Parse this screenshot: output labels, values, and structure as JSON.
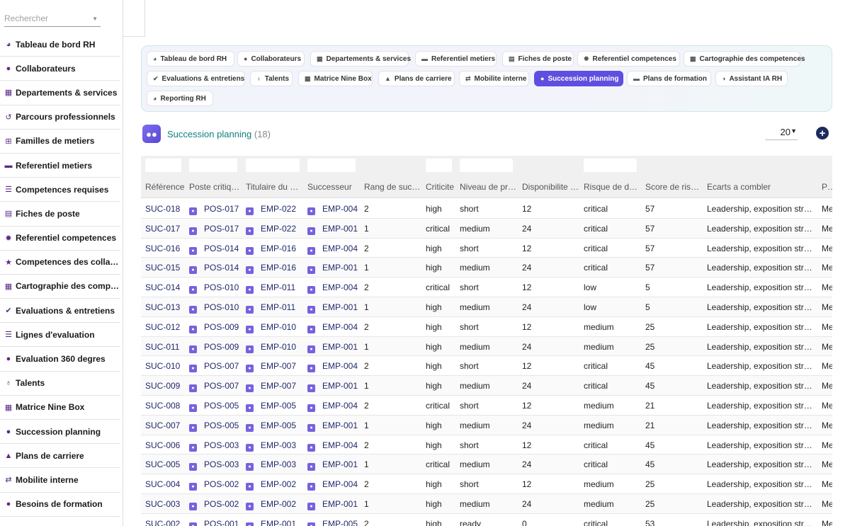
{
  "search": {
    "placeholder": "Rechercher"
  },
  "sidebar": {
    "items": [
      {
        "icon": "dashboard-icon",
        "glyph": "◕",
        "label": "Tableau de bord RH"
      },
      {
        "icon": "user-icon",
        "glyph": "●",
        "label": "Collaborateurs"
      },
      {
        "icon": "building-icon",
        "glyph": "▦",
        "label": "Departements & services"
      },
      {
        "icon": "history-icon",
        "glyph": "↺",
        "label": "Parcours professionnels"
      },
      {
        "icon": "sitemap-icon",
        "glyph": "⊞",
        "label": "Familles de metiers"
      },
      {
        "icon": "briefcase-icon",
        "glyph": "▬",
        "label": "Referentiel metiers"
      },
      {
        "icon": "list-icon",
        "glyph": "☰",
        "label": "Competences requises"
      },
      {
        "icon": "file-icon",
        "glyph": "▤",
        "label": "Fiches de poste"
      },
      {
        "icon": "gear-icon",
        "glyph": "✹",
        "label": "Referentiel competences"
      },
      {
        "icon": "star-icon",
        "glyph": "★",
        "label": "Competences des collaborateurs"
      },
      {
        "icon": "grid-icon",
        "glyph": "▦",
        "label": "Cartographie des competences"
      },
      {
        "icon": "clipboard-icon",
        "glyph": "✔",
        "label": "Evaluations & entretiens"
      },
      {
        "icon": "list-icon",
        "glyph": "☰",
        "label": "Lignes d'evaluation"
      },
      {
        "icon": "comments-icon",
        "glyph": "●",
        "label": "Evaluation 360 degres"
      },
      {
        "icon": "award-icon",
        "glyph": "♁",
        "label": "Talents"
      },
      {
        "icon": "ninebox-icon",
        "glyph": "▦",
        "label": "Matrice Nine Box"
      },
      {
        "icon": "user-tie-icon",
        "glyph": "●",
        "label": "Succession planning"
      },
      {
        "icon": "route-icon",
        "glyph": "▲",
        "label": "Plans de carriere"
      },
      {
        "icon": "exchange-icon",
        "glyph": "⇄",
        "label": "Mobilite interne"
      },
      {
        "icon": "lightbulb-icon",
        "glyph": "●",
        "label": "Besoins de formation"
      }
    ]
  },
  "tabs": [
    {
      "icon": "dashboard-icon",
      "glyph": "◕",
      "label": "Tableau de bord RH"
    },
    {
      "icon": "user-icon",
      "glyph": "●",
      "label": "Collaborateurs"
    },
    {
      "icon": "building-icon",
      "glyph": "▦",
      "label": "Departements & services"
    },
    {
      "icon": "briefcase-icon",
      "glyph": "▬",
      "label": "Referentiel metiers"
    },
    {
      "icon": "file-icon",
      "glyph": "▤",
      "label": "Fiches de poste"
    },
    {
      "icon": "gear-icon",
      "glyph": "✹",
      "label": "Referentiel competences"
    },
    {
      "icon": "grid-icon",
      "glyph": "▦",
      "label": "Cartographie des competences"
    },
    {
      "icon": "clipboard-icon",
      "glyph": "✔",
      "label": "Evaluations & entretiens"
    },
    {
      "icon": "award-icon",
      "glyph": "♁",
      "label": "Talents"
    },
    {
      "icon": "ninebox-icon",
      "glyph": "▦",
      "label": "Matrice Nine Box"
    },
    {
      "icon": "route-icon",
      "glyph": "▲",
      "label": "Plans de carriere"
    },
    {
      "icon": "exchange-icon",
      "glyph": "⇄",
      "label": "Mobilite interne"
    },
    {
      "icon": "user-tie-icon",
      "glyph": "●",
      "label": "Succession planning",
      "active": true
    },
    {
      "icon": "chalkboard-icon",
      "glyph": "▬",
      "label": "Plans de formation"
    },
    {
      "icon": "brain-icon",
      "glyph": "◑",
      "label": "Assistant IA RH"
    },
    {
      "icon": "chart-pie-icon",
      "glyph": "◕",
      "label": "Reporting RH"
    }
  ],
  "header": {
    "title": "Succession planning",
    "count": "(18)"
  },
  "pager": {
    "page_size": "20"
  },
  "colors": {
    "accent": "#5e4fe0",
    "title": "#0f7f7f",
    "link": "#1f2a6a",
    "icon": "#5b2a86"
  },
  "table": {
    "columns": [
      "Référence",
      "Poste critique",
      "Titulaire du poste",
      "Successeur",
      "Rang de succession",
      "Criticite",
      "Niveau de preparation",
      "Disponibilite (mois)",
      "Risque de depart",
      "Score de risque",
      "Ecarts a combler",
      "Plan"
    ],
    "rows": [
      [
        "SUC-018",
        "POS-017",
        "EMP-022",
        "EMP-004",
        "2",
        "high",
        "short",
        "12",
        "critical",
        "57",
        "Leadership, exposition strategique",
        "Me"
      ],
      [
        "SUC-017",
        "POS-017",
        "EMP-022",
        "EMP-001",
        "1",
        "critical",
        "medium",
        "24",
        "critical",
        "57",
        "Leadership, exposition strategique",
        "Me"
      ],
      [
        "SUC-016",
        "POS-014",
        "EMP-016",
        "EMP-004",
        "2",
        "high",
        "short",
        "12",
        "critical",
        "57",
        "Leadership, exposition strategique",
        "Me"
      ],
      [
        "SUC-015",
        "POS-014",
        "EMP-016",
        "EMP-001",
        "1",
        "high",
        "medium",
        "24",
        "critical",
        "57",
        "Leadership, exposition strategique",
        "Me"
      ],
      [
        "SUC-014",
        "POS-010",
        "EMP-011",
        "EMP-004",
        "2",
        "critical",
        "short",
        "12",
        "low",
        "5",
        "Leadership, exposition strategique",
        "Me"
      ],
      [
        "SUC-013",
        "POS-010",
        "EMP-011",
        "EMP-001",
        "1",
        "high",
        "medium",
        "24",
        "low",
        "5",
        "Leadership, exposition strategique",
        "Me"
      ],
      [
        "SUC-012",
        "POS-009",
        "EMP-010",
        "EMP-004",
        "2",
        "high",
        "short",
        "12",
        "medium",
        "25",
        "Leadership, exposition strategique",
        "Me"
      ],
      [
        "SUC-011",
        "POS-009",
        "EMP-010",
        "EMP-001",
        "1",
        "high",
        "medium",
        "24",
        "medium",
        "25",
        "Leadership, exposition strategique",
        "Me"
      ],
      [
        "SUC-010",
        "POS-007",
        "EMP-007",
        "EMP-004",
        "2",
        "high",
        "short",
        "12",
        "critical",
        "45",
        "Leadership, exposition strategique",
        "Me"
      ],
      [
        "SUC-009",
        "POS-007",
        "EMP-007",
        "EMP-001",
        "1",
        "high",
        "medium",
        "24",
        "critical",
        "45",
        "Leadership, exposition strategique",
        "Me"
      ],
      [
        "SUC-008",
        "POS-005",
        "EMP-005",
        "EMP-004",
        "2",
        "critical",
        "short",
        "12",
        "medium",
        "21",
        "Leadership, exposition strategique",
        "Me"
      ],
      [
        "SUC-007",
        "POS-005",
        "EMP-005",
        "EMP-001",
        "1",
        "high",
        "medium",
        "24",
        "medium",
        "21",
        "Leadership, exposition strategique",
        "Me"
      ],
      [
        "SUC-006",
        "POS-003",
        "EMP-003",
        "EMP-004",
        "2",
        "high",
        "short",
        "12",
        "critical",
        "45",
        "Leadership, exposition strategique",
        "Me"
      ],
      [
        "SUC-005",
        "POS-003",
        "EMP-003",
        "EMP-001",
        "1",
        "critical",
        "medium",
        "24",
        "critical",
        "45",
        "Leadership, exposition strategique",
        "Me"
      ],
      [
        "SUC-004",
        "POS-002",
        "EMP-002",
        "EMP-004",
        "2",
        "high",
        "short",
        "12",
        "medium",
        "25",
        "Leadership, exposition strategique",
        "Me"
      ],
      [
        "SUC-003",
        "POS-002",
        "EMP-002",
        "EMP-001",
        "1",
        "high",
        "medium",
        "24",
        "medium",
        "25",
        "Leadership, exposition strategique",
        "Me"
      ],
      [
        "SUC-002",
        "POS-001",
        "EMP-001",
        "EMP-005",
        "2",
        "high",
        "ready",
        "0",
        "critical",
        "53",
        "Leadership, exposition strategique",
        "Me"
      ]
    ]
  }
}
